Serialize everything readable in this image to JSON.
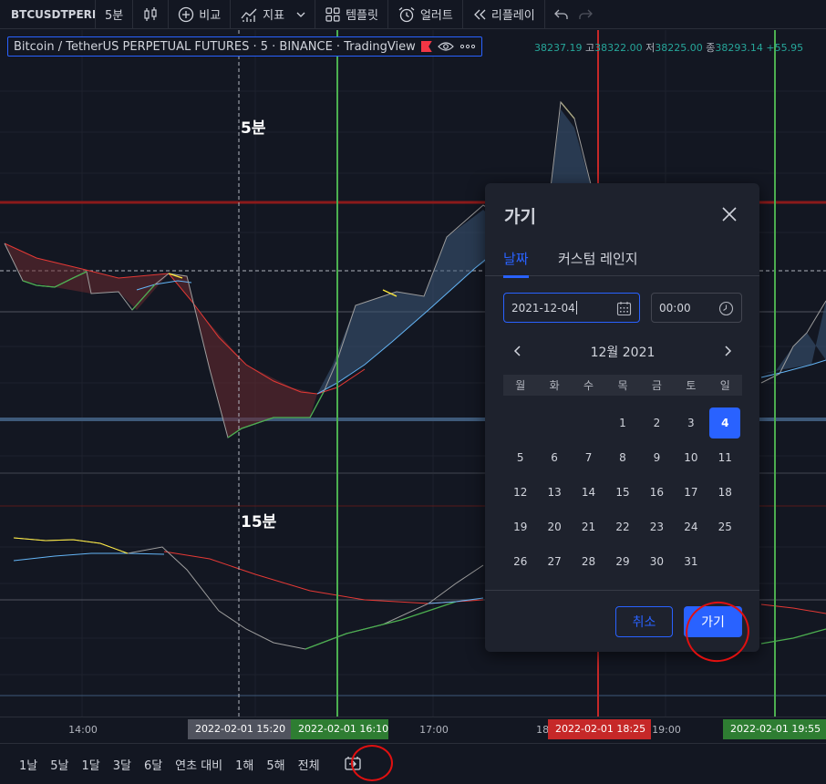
{
  "toolbar": {
    "symbol": "BTCUSDTPERP",
    "interval": "5분",
    "compare": "비교",
    "indicators": "지표",
    "templates": "템플릿",
    "alert": "얼러트",
    "replay": "리플레이"
  },
  "legend": {
    "title": "Bitcoin / TetherUS PERPETUAL FUTURES · 5 · BINANCE · TradingView"
  },
  "ohlc": {
    "o_value": "38237.19",
    "h_key": "고",
    "h_value": "38322.00",
    "l_key": "저",
    "l_value": "38225.00",
    "c_key": "종",
    "c_value": "38293.14",
    "change": "+55.95"
  },
  "panes": {
    "top_label": "5분",
    "bottom_label": "15분"
  },
  "time_axis": {
    "ticks": [
      "14:00",
      "17:00",
      "18:",
      "19:00"
    ],
    "badge_cursor": "2022-02-01    15:20",
    "badge_green1": "2022-02-01    16:10",
    "badge_red": "2022-02-01    18:25",
    "badge_green2": "2022-02-01    19:55"
  },
  "range_bar": {
    "items": [
      "1날",
      "5날",
      "1달",
      "3달",
      "6달",
      "연초 대비",
      "1해",
      "5해",
      "전체"
    ]
  },
  "dialog": {
    "title": "가기",
    "tab_date": "날짜",
    "tab_custom": "커스텀 레인지",
    "date_value": "2021-12-04",
    "time_value": "00:00",
    "month": "12월 2021",
    "weekdays": [
      "월",
      "화",
      "수",
      "목",
      "금",
      "토",
      "일"
    ],
    "days": [
      "",
      "",
      "",
      "1",
      "2",
      "3",
      "4",
      "5",
      "6",
      "7",
      "8",
      "9",
      "10",
      "11",
      "12",
      "13",
      "14",
      "15",
      "16",
      "17",
      "18",
      "19",
      "20",
      "21",
      "22",
      "23",
      "24",
      "25",
      "26",
      "27",
      "28",
      "29",
      "30",
      "31"
    ],
    "selected_day": "4",
    "cancel": "취소",
    "go": "가기"
  },
  "colors": {
    "background": "#131722",
    "accent": "#2962ff",
    "green_line": "#4caf50",
    "red_line": "#f23645"
  }
}
